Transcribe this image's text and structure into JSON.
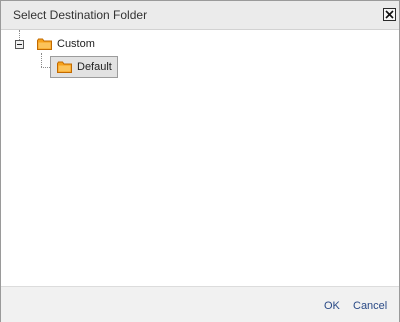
{
  "dialog": {
    "title": "Select Destination Folder",
    "close_icon": "close-icon"
  },
  "tree": {
    "nodes": [
      {
        "label": "Custom",
        "icon": "folder-icon",
        "expanded": true,
        "selected": false
      },
      {
        "label": "Default",
        "icon": "folder-icon",
        "expanded": false,
        "selected": true
      }
    ]
  },
  "footer": {
    "ok_label": "OK",
    "cancel_label": "Cancel"
  },
  "colors": {
    "folder_fill": "#f7a21b",
    "folder_stroke": "#c26a00",
    "link": "#2a4a86",
    "selected_bg": "#e2e2e2"
  }
}
